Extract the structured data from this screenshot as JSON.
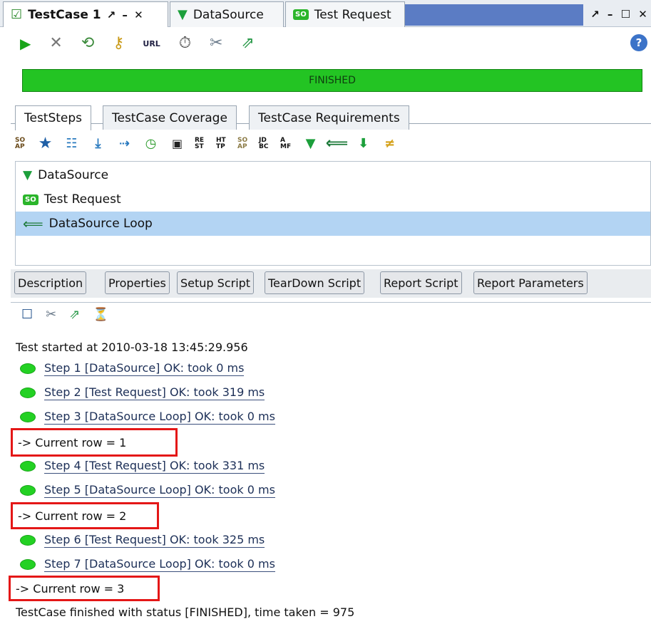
{
  "window": {
    "tabs": [
      {
        "label": "TestCase 1",
        "icon": "testcase-check-icon",
        "active": true
      },
      {
        "label": "DataSource",
        "icon": "datasource-funnel-icon",
        "active": false
      },
      {
        "label": "Test Request",
        "icon": "soap-request-icon",
        "active": false
      }
    ]
  },
  "toolbar": {
    "icons": [
      "run-icon",
      "cancel-icon",
      "loop-icon",
      "credentials-key-icon",
      "url-icon",
      "timer-icon",
      "options-tools-icon",
      "export-icon",
      "help-icon"
    ],
    "url_label": "URL",
    "help_label": "?"
  },
  "status": {
    "label": "FINISHED",
    "color": "#23c423"
  },
  "panel_tabs": [
    "TestSteps",
    "TestCase Coverage",
    "TestCase Requirements"
  ],
  "step_toolbar": {
    "labels": [
      "SO AP",
      "RE ST",
      "HT TP",
      "SO AP",
      "JD BC",
      "A MF"
    ]
  },
  "steps": [
    {
      "label": "DataSource",
      "icon": "datasource-funnel-icon",
      "selected": false
    },
    {
      "label": "Test Request",
      "icon": "soap-request-icon",
      "selected": false
    },
    {
      "label": "DataSource Loop",
      "icon": "loop-arrow-icon",
      "selected": true
    }
  ],
  "bottom_tabs": [
    "Description",
    "Properties",
    "Setup Script",
    "TearDown Script",
    "Report Script",
    "Report Parameters"
  ],
  "log": {
    "started": "Test started at 2010-03-18 13:45:29.956",
    "entries": [
      {
        "type": "step",
        "text": "Step 1 [DataSource] OK: took 0 ms"
      },
      {
        "type": "step",
        "text": "Step 2 [Test Request] OK: took 319 ms"
      },
      {
        "type": "step",
        "text": "Step 3 [DataSource Loop] OK: took 0 ms"
      },
      {
        "type": "row",
        "text": "-> Current row = 1"
      },
      {
        "type": "step",
        "text": "Step 4 [Test Request] OK: took 331 ms"
      },
      {
        "type": "step",
        "text": "Step 5 [DataSource Loop] OK: took 0 ms"
      },
      {
        "type": "row",
        "text": "-> Current row = 2"
      },
      {
        "type": "step",
        "text": "Step 6 [Test Request] OK: took 325 ms"
      },
      {
        "type": "step",
        "text": "Step 7 [DataSource Loop] OK: took 0 ms"
      },
      {
        "type": "row",
        "text": "-> Current row = 3"
      }
    ],
    "finished": "TestCase finished with status [FINISHED], time taken = 975"
  },
  "colors": {
    "status_green": "#23c423",
    "selection": "#b3d4f3",
    "highlight_box": "#e41717",
    "step_ok": "#23d123"
  }
}
